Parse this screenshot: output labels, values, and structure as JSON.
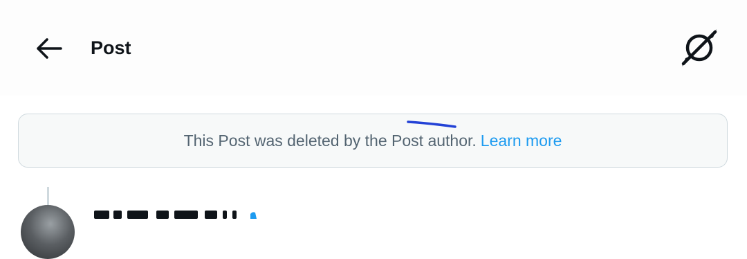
{
  "header": {
    "title": "Post",
    "back_icon": "arrow-left-icon",
    "right_icon": "grok-icon"
  },
  "notice": {
    "message": "This Post was deleted by the Post author.",
    "link_label": "Learn more"
  },
  "colors": {
    "text_primary": "#0f1419",
    "text_secondary": "#536471",
    "link": "#1d9bf0",
    "border": "#cfd9de",
    "stroke": "#2342d6"
  }
}
